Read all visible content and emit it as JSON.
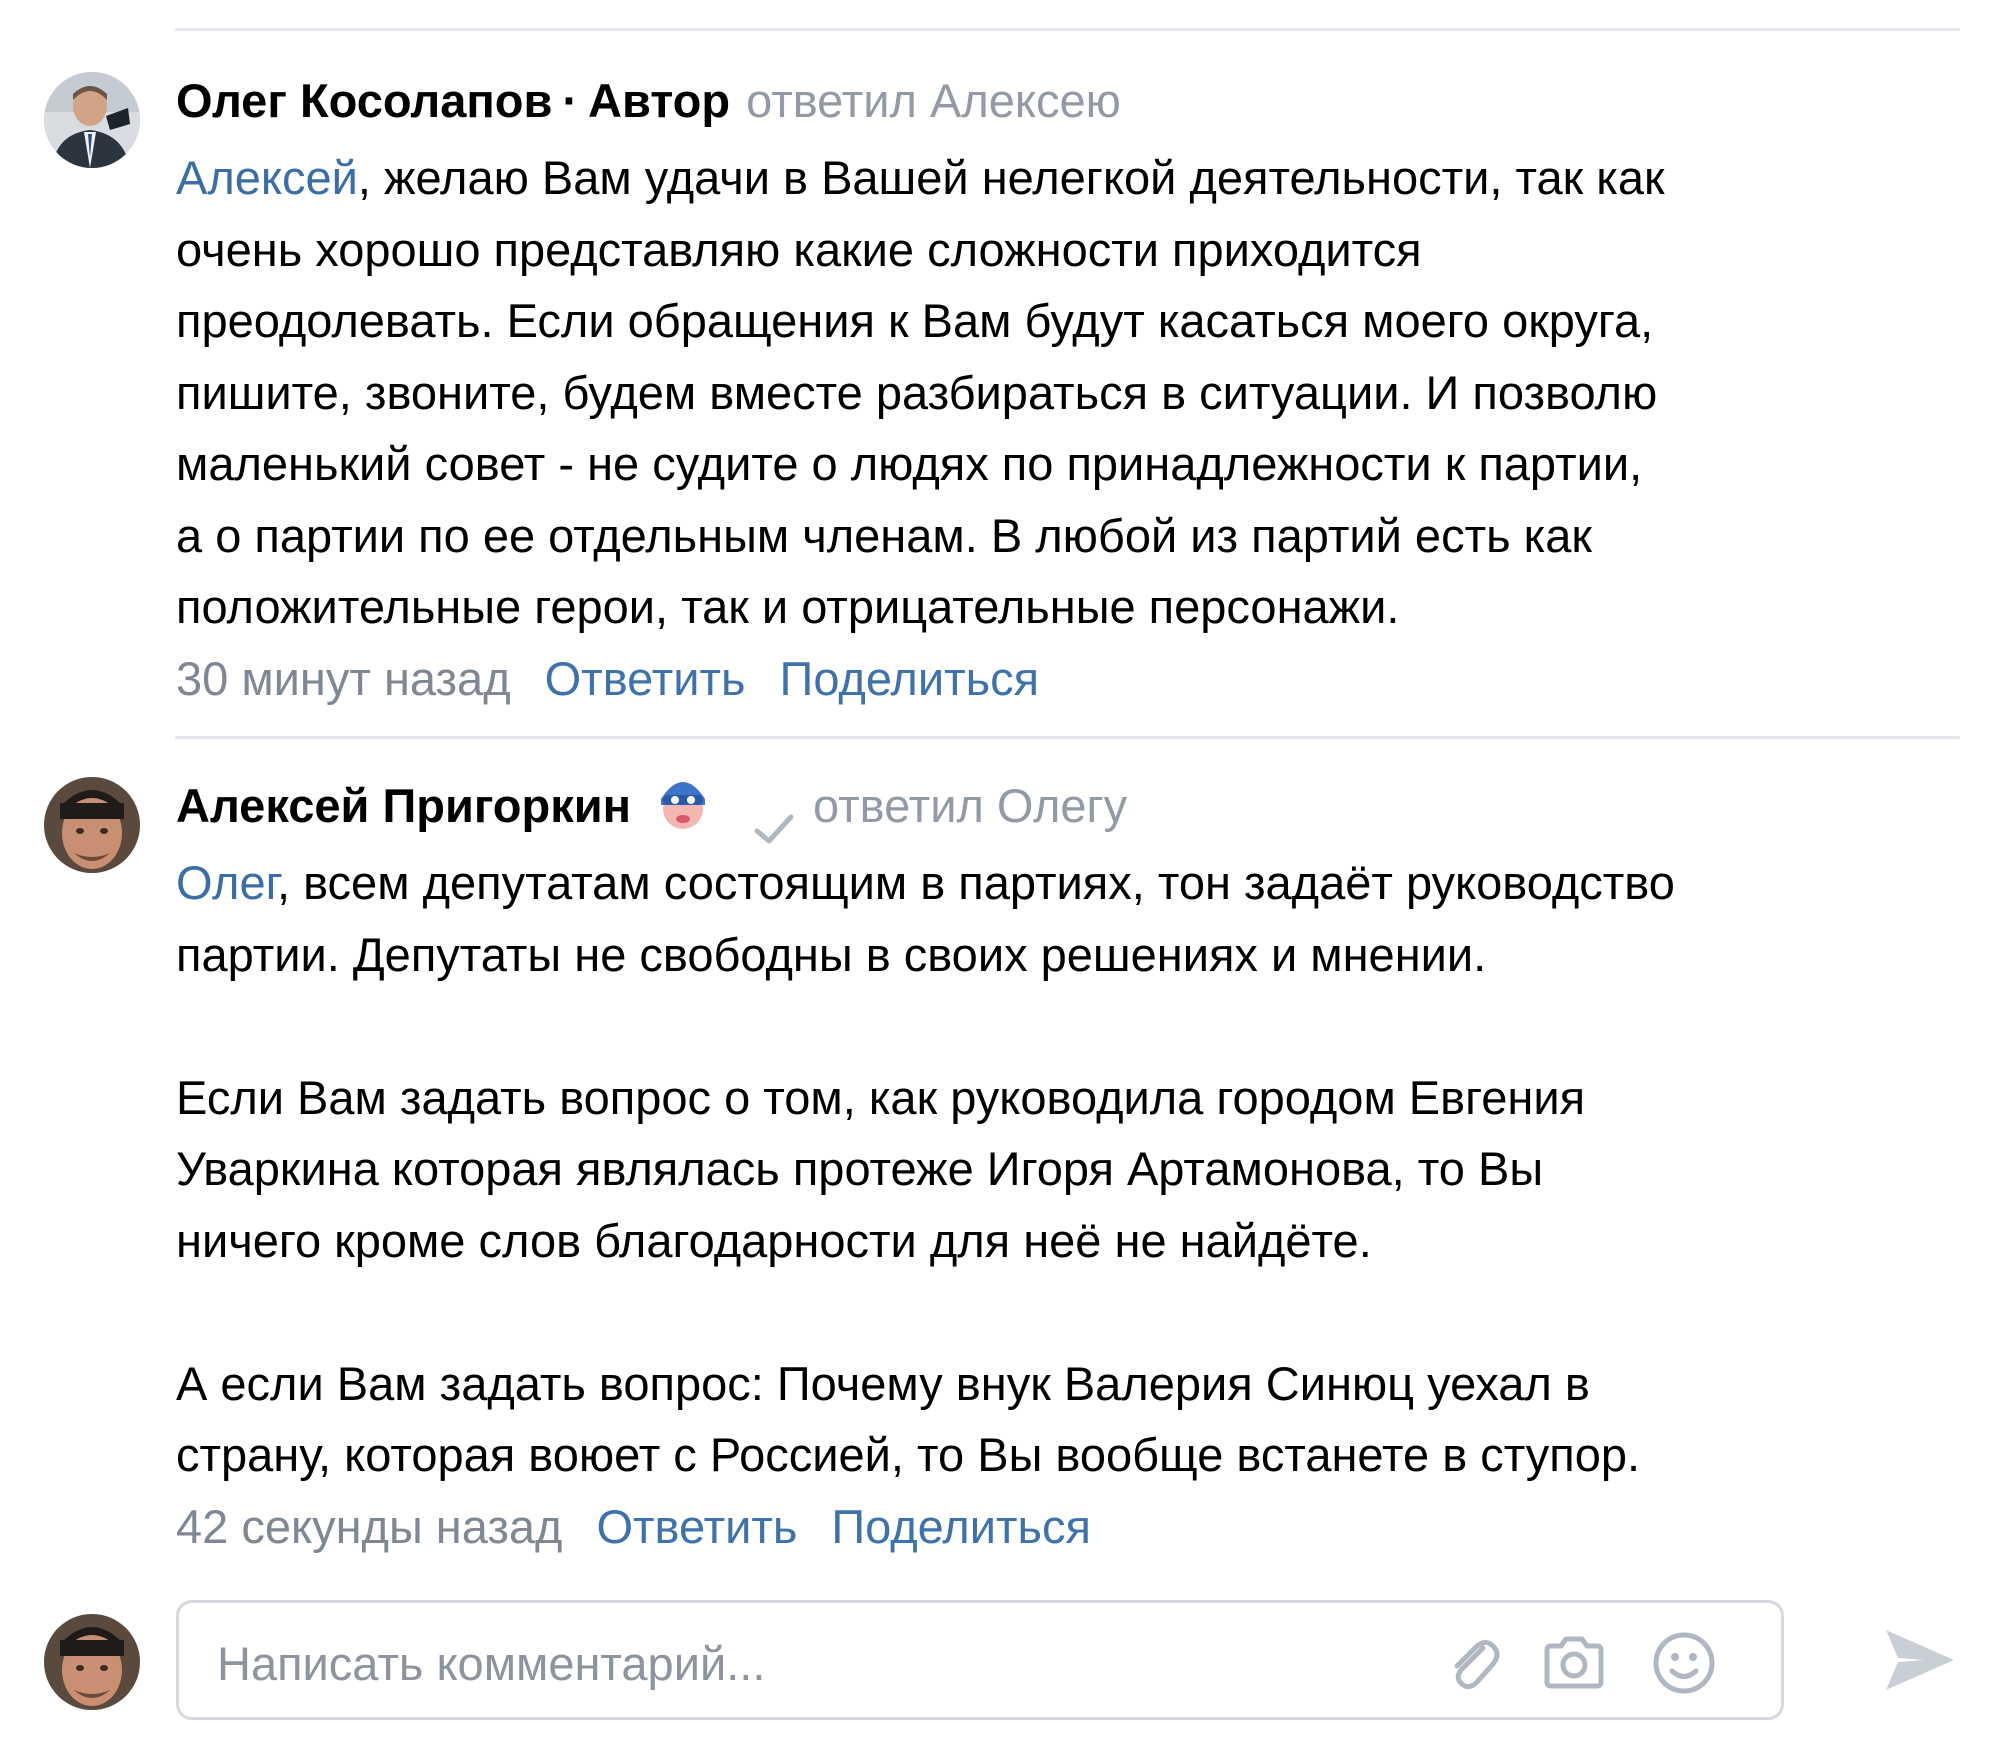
{
  "comments": [
    {
      "author": "Олег Косолапов",
      "separator": "·",
      "role": "Автор",
      "reply_to": "ответил Алексею",
      "mention": "Алексей",
      "text": ", желаю Вам удачи в Вашей нелегкой деятельности, так как\nочень хорошо представляю какие сложности приходится\nпреодолевать. Если обращения к Вам будут касаться моего округа,\nпишите, звоните, будем вместе разбираться в ситуации. И позволю\nмаленький совет - не судите о людях по принадлежности к партии,\nа о партии по ее отдельным членам. В любой из партий есть как\nположительные герои, так и отрицательные персонажи.",
      "time": "30 минут назад",
      "reply_label": "Ответить",
      "share_label": "Поделиться"
    },
    {
      "author": "Алексей Пригоркин",
      "reply_to": "ответил Олегу",
      "mention": "Олег",
      "text": ", всем депутатам состоящим в партиях, тон задаёт руководство\nпартии. Депутаты не свободны в своих решениях и мнении.\n\nЕсли Вам задать вопрос о том, как руководила городом Евгения\nУваркина которая являлась протеже Игоря Артамонова, то Вы\nничего кроме слов благодарности для неё не найдёте.\n\nА если Вам задать вопрос: Почему внук Валерия Синюц уехал в\nстрану, которая воюет с Россией, то Вы вообще встанете в ступор.",
      "time": "42 секунды назад",
      "reply_label": "Ответить",
      "share_label": "Поделиться"
    }
  ],
  "composer": {
    "placeholder": "Написать комментарий..."
  },
  "icons": {
    "attach": "paperclip-icon",
    "camera": "camera-icon",
    "emoji": "smile-icon",
    "send": "send-icon",
    "verified": "checkmark-icon",
    "badge": "mask-badge-icon"
  },
  "colors": {
    "link": "#3e72a8",
    "muted": "#939aa5",
    "divider": "#e3e7ec",
    "icon": "#aeb7c2"
  }
}
